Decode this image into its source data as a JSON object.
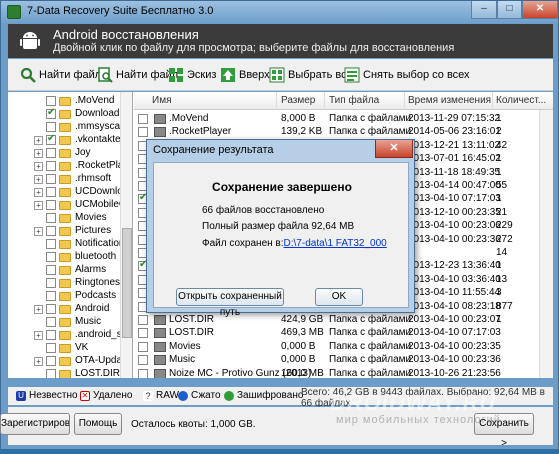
{
  "window": {
    "title": "7-Data Recovery Suite Бесплатно 3.0",
    "min": "–",
    "max": "□",
    "close": "✕"
  },
  "header": {
    "title": "Android восстановления",
    "subtitle": "Двойной клик по файлу для просмотра; выберите файлы для восстановления"
  },
  "toolbar": {
    "find_files": "Найти файлы",
    "find_file": "Найти файл",
    "thumbnails": "Эскиз",
    "up": "Вверх",
    "select_all": "Выбрать всё",
    "deselect_all": "Снять выбор со всех"
  },
  "tree": [
    {
      "label": ".MoVend",
      "checked": false,
      "expand": ""
    },
    {
      "label": "Download",
      "checked": true,
      "expand": ""
    },
    {
      "label": ".mmsyscache",
      "checked": false,
      "expand": ""
    },
    {
      "label": ".vkontakte",
      "checked": true,
      "expand": "+"
    },
    {
      "label": "Joy",
      "checked": false,
      "expand": "+"
    },
    {
      "label": ".RocketPlayer",
      "checked": false,
      "expand": "+"
    },
    {
      "label": ".rhmsoft",
      "checked": false,
      "expand": "+"
    },
    {
      "label": "UCDownloads",
      "checked": false,
      "expand": "+"
    },
    {
      "label": "UCMobileCo",
      "checked": false,
      "expand": "+"
    },
    {
      "label": "Movies",
      "checked": false,
      "expand": ""
    },
    {
      "label": "Pictures",
      "checked": false,
      "expand": "+"
    },
    {
      "label": "Notifications",
      "checked": false,
      "expand": ""
    },
    {
      "label": "bluetooth",
      "checked": false,
      "expand": ""
    },
    {
      "label": "Alarms",
      "checked": false,
      "expand": ""
    },
    {
      "label": "Ringtones",
      "checked": false,
      "expand": ""
    },
    {
      "label": "Podcasts",
      "checked": false,
      "expand": ""
    },
    {
      "label": "Android",
      "checked": false,
      "expand": "+"
    },
    {
      "label": "Music",
      "checked": false,
      "expand": ""
    },
    {
      "label": ".android_secu",
      "checked": false,
      "expand": "+"
    },
    {
      "label": "VK",
      "checked": false,
      "expand": ""
    },
    {
      "label": "OTA-Updates",
      "checked": false,
      "expand": "+"
    },
    {
      "label": "LOST.DIR",
      "checked": false,
      "expand": ""
    }
  ],
  "list_headers": {
    "name": "Имя",
    "size": "Размер",
    "type": "Тип файла",
    "time": "Время изменения",
    "count": "Количест..."
  },
  "rows": [
    {
      "name": ".MoVend",
      "size": "8,000 B",
      "type": "Папка с файлами",
      "time": "2013-11-29 07:15:32",
      "count": "1",
      "checked": false
    },
    {
      "name": ".RocketPlayer",
      "size": "139,2 KB",
      "type": "Папка с файлами",
      "time": "2014-05-06 23:16:01",
      "count": "2",
      "checked": false
    },
    {
      "name": "",
      "size": "",
      "type": "",
      "time": "2013-12-21 13:11:02",
      "count": "42",
      "checked": false
    },
    {
      "name": "",
      "size": "",
      "type": "",
      "time": "2013-07-01 16:45:02",
      "count": "1",
      "checked": false
    },
    {
      "name": "",
      "size": "",
      "type": "",
      "time": "2013-11-18 18:49:35",
      "count": "1",
      "checked": false
    },
    {
      "name": "",
      "size": "",
      "type": "",
      "time": "2013-04-14 00:47:00",
      "count": "55",
      "checked": false
    },
    {
      "name": "",
      "size": "",
      "type": "",
      "time": "2013-04-10 07:17:03",
      "count": "1",
      "checked": true
    },
    {
      "name": "",
      "size": "",
      "type": "",
      "time": "2013-12-10 00:23:35",
      "count": "21",
      "checked": false
    },
    {
      "name": "",
      "size": "",
      "type": "",
      "time": "2013-04-10 00:23:06",
      "count": "229",
      "checked": false
    },
    {
      "name": "",
      "size": "",
      "type": "",
      "time": "2013-04-10 00:23:36",
      "count": "272",
      "checked": false
    },
    {
      "name": "",
      "size": "",
      "type": "",
      "time": "",
      "count": "14",
      "checked": false
    },
    {
      "name": "",
      "size": "",
      "type": "",
      "time": "2013-12-23 13:36:40",
      "count": "1",
      "checked": true
    },
    {
      "name": "",
      "size": "",
      "type": "",
      "time": "2013-04-10 03:36:40",
      "count": "13",
      "checked": false
    },
    {
      "name": "",
      "size": "",
      "type": "",
      "time": "2013-04-10 11:55:44",
      "count": "3",
      "checked": false
    },
    {
      "name": "",
      "size": "",
      "type": "",
      "time": "2013-04-10 08:23:18",
      "count": "877",
      "checked": false
    },
    {
      "name": "LOST.DIR",
      "size": "424,9 GB",
      "type": "Папка с файлами",
      "time": "2013-04-10 00:23:07",
      "count": "1",
      "checked": false
    },
    {
      "name": "LOST.DIR",
      "size": "469,3 MB",
      "type": "Папка с файлами",
      "time": "2013-04-10 07:17:03",
      "count": "",
      "checked": false
    },
    {
      "name": "Movies",
      "size": "0,000 B",
      "type": "Папка с файлами",
      "time": "2013-04-10 00:23:35",
      "count": "",
      "checked": false
    },
    {
      "name": "Music",
      "size": "0,000 B",
      "type": "Папка с файлами",
      "time": "2013-04-10 00:23:36",
      "count": "",
      "checked": false
    },
    {
      "name": "Noize MC - Protivo Gunz (2013)",
      "size": "160,0 MB",
      "type": "Папка с файлами",
      "time": "2013-10-26 21:23:56",
      "count": "",
      "checked": false
    }
  ],
  "legend": {
    "nonexistent": "Незвестно",
    "deleted": "Удалено",
    "raw": "RAW",
    "compressed": "Сжато",
    "encrypted": "Зашифровано"
  },
  "stats": "Всего: 46,2 GB в 9443 файлах. Выбрано: 92,64 MB в 66 файлах",
  "bottom": {
    "register": "Зарегистрироваться",
    "help": "Помощь",
    "quota": "Осталось квоты: 1,000 GB.",
    "save": "Сохранить >"
  },
  "dialog": {
    "title": "Сохранение результата",
    "heading": "Сохранение завершено",
    "line1": "66 файлов восстановлено",
    "line2": "Полный размер файла 92,64 MB",
    "line3": "Файл сохранен в:",
    "path": "D:\\7-data\\1 FAT32_000",
    "open_btn": "Открыть сохраненный путь",
    "ok_btn": "OK",
    "close": "✕"
  },
  "watermark": {
    "text": "DROIDWAY.RU",
    "sub": "мир мобильных технологий"
  },
  "colors": {
    "header_bg": "#3b3b3b",
    "title_bar": "#6f9fcb",
    "close_red": "#c7442c",
    "link": "#0033cc",
    "folder": "#f2c74f"
  }
}
